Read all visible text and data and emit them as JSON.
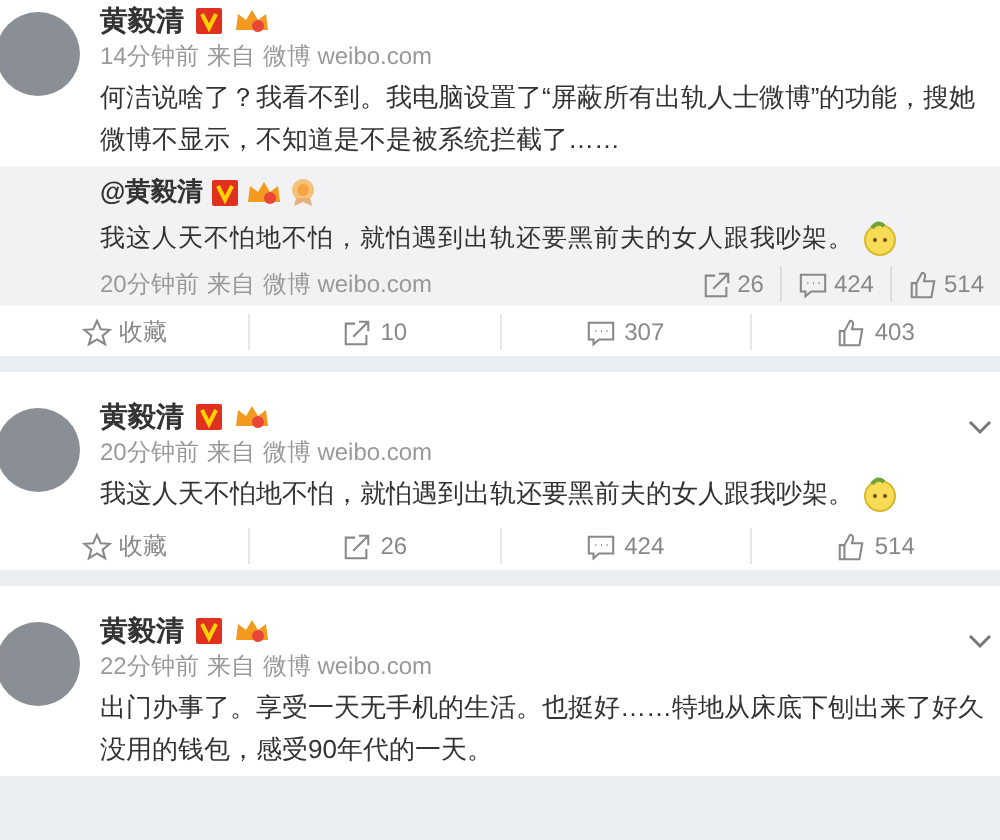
{
  "posts": [
    {
      "author": "黄毅清",
      "badges": [
        {
          "kind": "verified"
        },
        {
          "kind": "crown"
        }
      ],
      "time": "14分钟前",
      "source_prefix": "来自",
      "source": "微博 weibo.com",
      "text": "何洁说啥了？我看不到。我电脑设置了“屏蔽所有出轨人士微博”的功能，搜她微博不显示，不知道是不是被系统拦截了……",
      "emoji": false,
      "menu": false,
      "quote": {
        "author": "@黄毅清",
        "badges": [
          {
            "kind": "verified"
          },
          {
            "kind": "crown"
          },
          {
            "kind": "medal"
          }
        ],
        "text": "我这人天不怕地不怕，就怕遇到出轨还要黑前夫的女人跟我吵架。",
        "emoji": true,
        "time": "20分钟前",
        "source_prefix": "来自",
        "source": "微博 weibo.com",
        "stats": [
          {
            "kind": "repost",
            "label": "26"
          },
          {
            "kind": "comment",
            "label": "424"
          },
          {
            "kind": "like",
            "label": "514"
          }
        ]
      },
      "actions": [
        {
          "kind": "favorite",
          "label": "收藏"
        },
        {
          "kind": "repost",
          "label": "10"
        },
        {
          "kind": "comment",
          "label": "307"
        },
        {
          "kind": "like",
          "label": "403"
        }
      ]
    },
    {
      "author": "黄毅清",
      "badges": [
        {
          "kind": "verified"
        },
        {
          "kind": "crown"
        }
      ],
      "time": "20分钟前",
      "source_prefix": "来自",
      "source": "微博 weibo.com",
      "text": "我这人天不怕地不怕，就怕遇到出轨还要黑前夫的女人跟我吵架。",
      "emoji": true,
      "menu": true,
      "actions": [
        {
          "kind": "favorite",
          "label": "收藏"
        },
        {
          "kind": "repost",
          "label": "26"
        },
        {
          "kind": "comment",
          "label": "424"
        },
        {
          "kind": "like",
          "label": "514"
        }
      ]
    },
    {
      "author": "黄毅清",
      "badges": [
        {
          "kind": "verified"
        },
        {
          "kind": "crown"
        }
      ],
      "time": "22分钟前",
      "source_prefix": "来自",
      "source": "微博 weibo.com",
      "text": "出门办事了。享受一天无手机的生活。也挺好……特地从床底下刨出来了好久没用的钱包，感受90年代的一天。",
      "emoji": false,
      "menu": true
    }
  ]
}
